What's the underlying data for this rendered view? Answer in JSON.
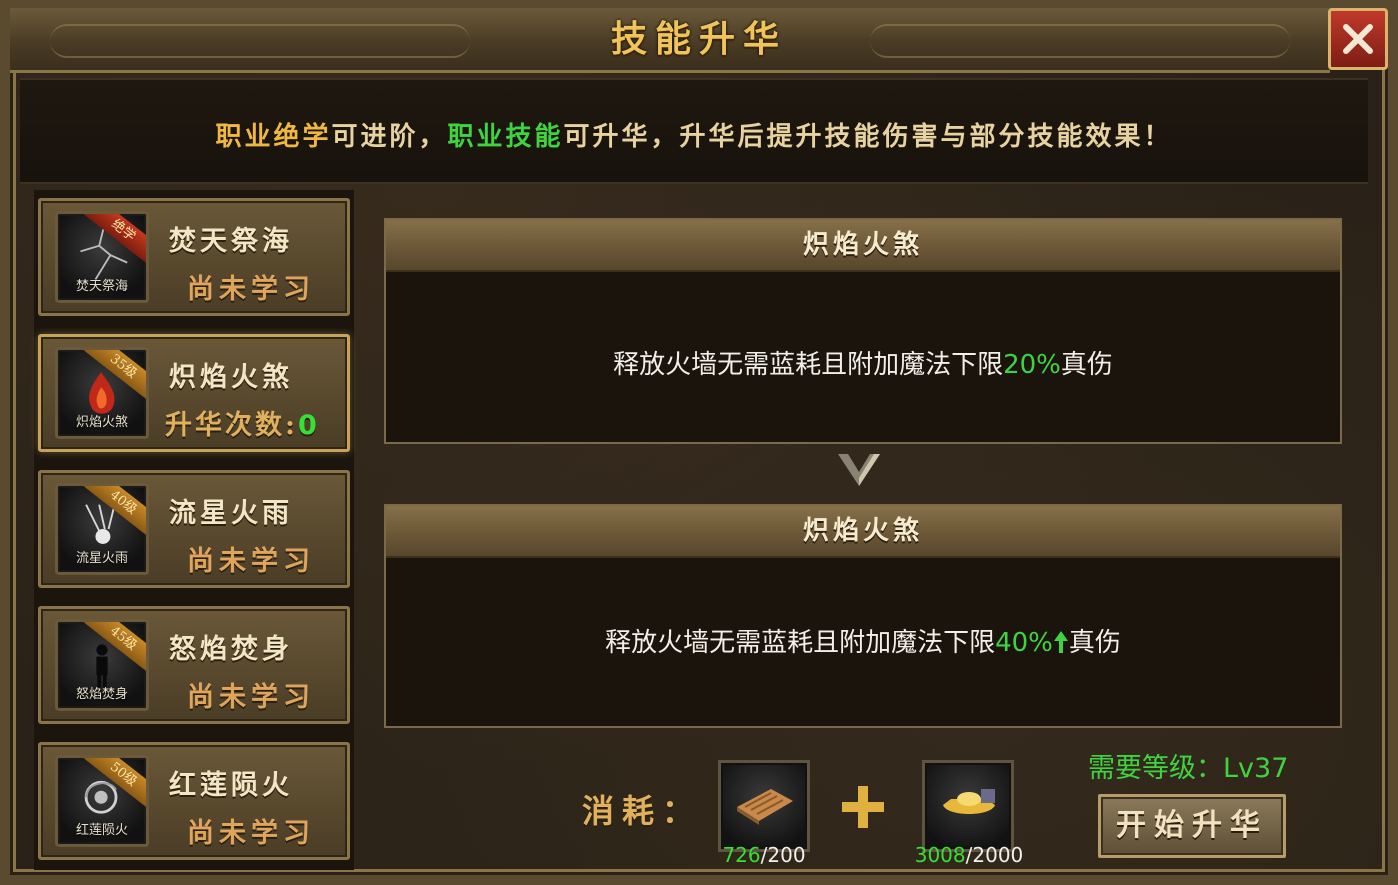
{
  "window": {
    "title": "技能升华",
    "close_label": "✕"
  },
  "notice": {
    "part1": "职业绝学",
    "part2": "可进阶，",
    "part3": "职业技能",
    "part4": "可升华，升华后提升技能伤害与部分技能效果！"
  },
  "skills": [
    {
      "name": "焚天祭海",
      "icon_name": "焚天祭海",
      "badge": "绝学",
      "status": "尚未学习"
    },
    {
      "name": "炽焰火煞",
      "icon_name": "炽焰火煞",
      "badge": "35级",
      "status_label": "升华次数:",
      "status_value": "0"
    },
    {
      "name": "流星火雨",
      "icon_name": "流星火雨",
      "badge": "40级",
      "status": "尚未学习"
    },
    {
      "name": "怒焰焚身",
      "icon_name": "怒焰焚身",
      "badge": "45级",
      "status": "尚未学习"
    },
    {
      "name": "红莲陨火",
      "icon_name": "红莲陨火",
      "badge": "50级",
      "status": "尚未学习"
    }
  ],
  "current": {
    "title": "炽焰火煞",
    "desc_prefix": "释放火墙无需蓝耗且附加魔法下限",
    "value": "20%",
    "desc_suffix": "真伤"
  },
  "next": {
    "title": "炽焰火煞",
    "desc_prefix": "释放火墙无需蓝耗且附加魔法下限",
    "value": "40%",
    "desc_suffix": "真伤"
  },
  "requirement": "需要等级：Lv37",
  "cost": {
    "label": "消耗：",
    "items": [
      {
        "icon": "scroll-icon",
        "have": "726",
        "need": "/200"
      },
      {
        "icon": "gold-ingot-icon",
        "have": "3008",
        "need": "/2000"
      }
    ]
  },
  "upgrade_button": "开始升华",
  "colors": {
    "gold": "#f0c45a",
    "green": "#3fd43f",
    "frame": "#5a4a30"
  }
}
